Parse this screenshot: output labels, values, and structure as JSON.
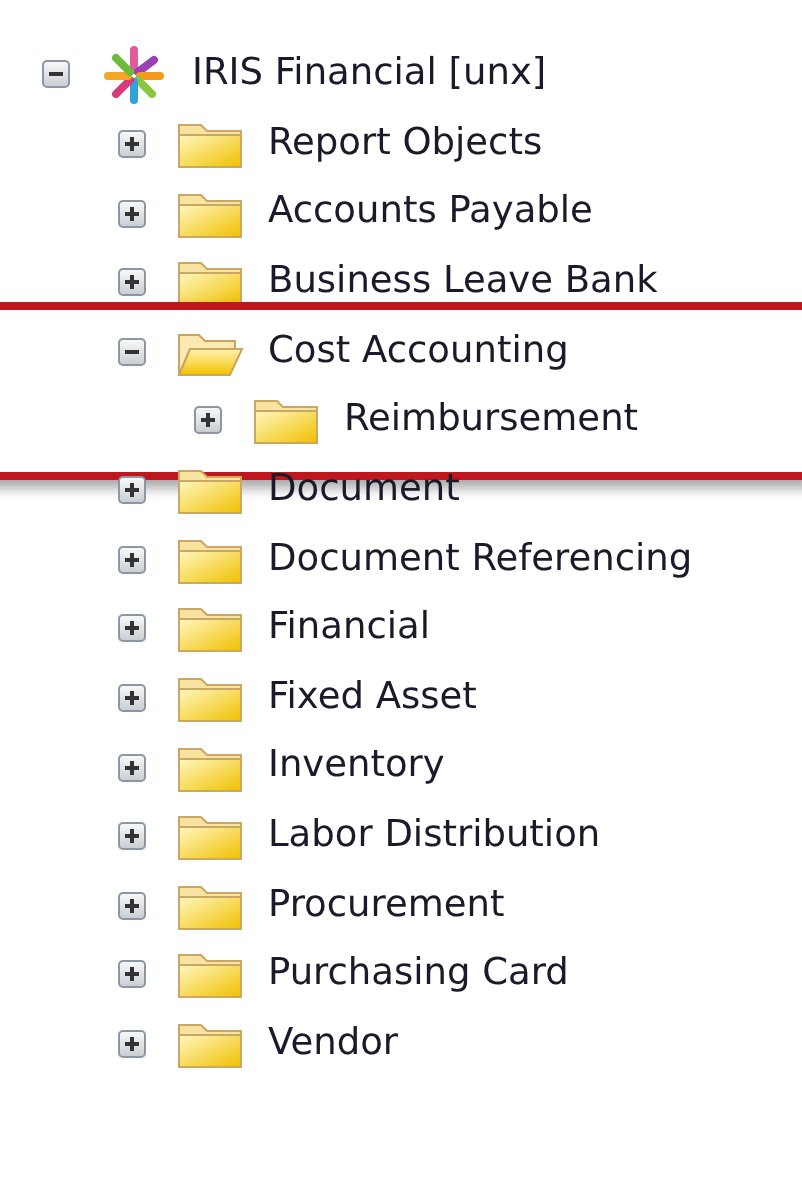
{
  "tree": {
    "label": "IRIS Financial [unx]",
    "kind": "universe",
    "expanded": true,
    "children": [
      {
        "label": "Report Objects",
        "kind": "folder",
        "expanded": false
      },
      {
        "label": "Accounts Payable",
        "kind": "folder",
        "expanded": false
      },
      {
        "label": "Business Leave Bank",
        "kind": "folder",
        "expanded": false
      },
      {
        "label": "Cost Accounting",
        "kind": "folder",
        "expanded": true,
        "highlighted": true,
        "children": [
          {
            "label": "Reimbursement",
            "kind": "folder",
            "expanded": false
          }
        ]
      },
      {
        "label": "Document",
        "kind": "folder",
        "expanded": false
      },
      {
        "label": "Document Referencing",
        "kind": "folder",
        "expanded": false
      },
      {
        "label": "Financial",
        "kind": "folder",
        "expanded": false
      },
      {
        "label": "Fixed Asset",
        "kind": "folder",
        "expanded": false
      },
      {
        "label": "Inventory",
        "kind": "folder",
        "expanded": false
      },
      {
        "label": "Labor Distribution",
        "kind": "folder",
        "expanded": false
      },
      {
        "label": "Procurement",
        "kind": "folder",
        "expanded": false
      },
      {
        "label": "Purchasing Card",
        "kind": "folder",
        "expanded": false
      },
      {
        "label": "Vendor",
        "kind": "folder",
        "expanded": false
      }
    ]
  }
}
